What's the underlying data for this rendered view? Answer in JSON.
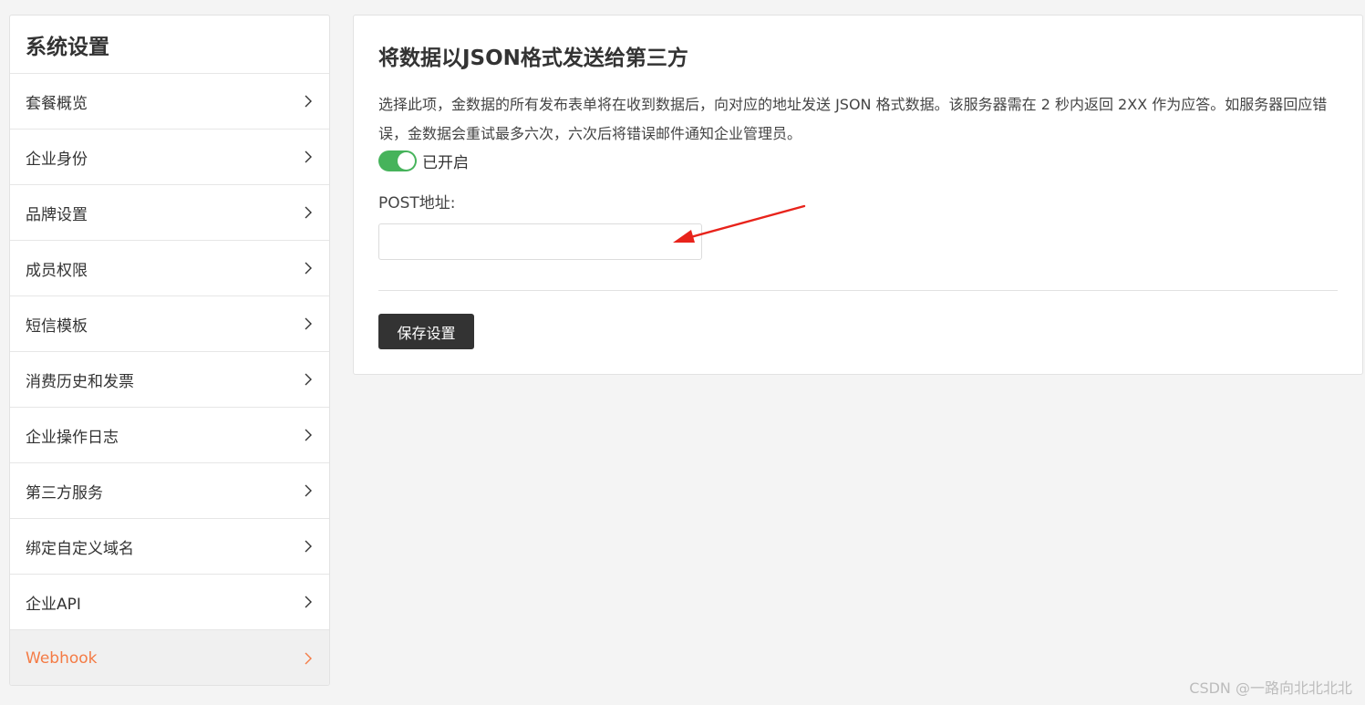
{
  "sidebar": {
    "title": "系统设置",
    "items": [
      {
        "label": "套餐概览",
        "active": false
      },
      {
        "label": "企业身份",
        "active": false
      },
      {
        "label": "品牌设置",
        "active": false
      },
      {
        "label": "成员权限",
        "active": false
      },
      {
        "label": "短信模板",
        "active": false
      },
      {
        "label": "消费历史和发票",
        "active": false
      },
      {
        "label": "企业操作日志",
        "active": false
      },
      {
        "label": "第三方服务",
        "active": false
      },
      {
        "label": "绑定自定义域名",
        "active": false
      },
      {
        "label": "企业API",
        "active": false
      },
      {
        "label": "Webhook",
        "active": true
      }
    ]
  },
  "main": {
    "title": "将数据以JSON格式发送给第三方",
    "description": "选择此项，金数据的所有发布表单将在收到数据后，向对应的地址发送 JSON 格式数据。该服务器需在 2 秒内返回 2XX 作为应答。如服务器回应错误，金数据会重试最多六次，六次后将错误邮件通知企业管理员。",
    "toggle": {
      "enabled": true,
      "label": "已开启"
    },
    "post_label": "POST地址:",
    "post_value": "",
    "save_label": "保存设置"
  },
  "colors": {
    "accent": "#f47b45",
    "toggle_on": "#46b35b",
    "button_bg": "#333333",
    "annotation_arrow": "#e8231b"
  },
  "watermark": "CSDN @一路向北北北北"
}
